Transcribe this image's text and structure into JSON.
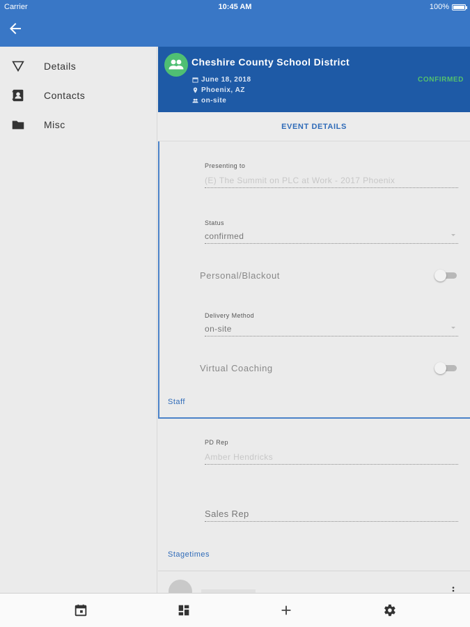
{
  "status_bar": {
    "carrier": "Carrier",
    "time": "10:45 AM",
    "battery": "100%"
  },
  "app_bar": {
    "back_icon": "arrow-left-icon"
  },
  "sidebar": {
    "items": [
      {
        "label": "Details",
        "icon": "filter-triangle-icon"
      },
      {
        "label": "Contacts",
        "icon": "contacts-icon"
      },
      {
        "label": "Misc",
        "icon": "folder-icon"
      }
    ]
  },
  "event": {
    "title": "Cheshire County School District",
    "date": "June 18, 2018",
    "location": "Phoenix, AZ",
    "delivery": "on-site",
    "status": "CONFIRMED",
    "status_color": "#54c06e",
    "avatar_color": "#4fbf73"
  },
  "tab": {
    "label": "EVENT DETAILS"
  },
  "form": {
    "presenting_to": {
      "label": "Presenting to",
      "value": "(E) The Summit on PLC at Work - 2017 Phoenix"
    },
    "status": {
      "label": "Status",
      "value": "confirmed"
    },
    "personal_blackout": {
      "label": "Personal/Blackout",
      "on": false
    },
    "delivery_method": {
      "label": "Delivery Method",
      "value": "on-site"
    },
    "virtual_coaching": {
      "label": "Virtual Coaching",
      "on": false
    }
  },
  "staff": {
    "title": "Staff",
    "pd_rep": {
      "label": "PD Rep",
      "value": "Amber Hendricks"
    },
    "sales_rep": {
      "placeholder": "Sales Rep"
    }
  },
  "stagetimes": {
    "title": "Stagetimes"
  },
  "bottom_nav": {
    "items": [
      "calendar-icon",
      "dashboard-icon",
      "add-icon",
      "settings-icon"
    ]
  },
  "colors": {
    "primary": "#3977c6",
    "header": "#1e5aa6",
    "accent": "#2f6bb8"
  }
}
